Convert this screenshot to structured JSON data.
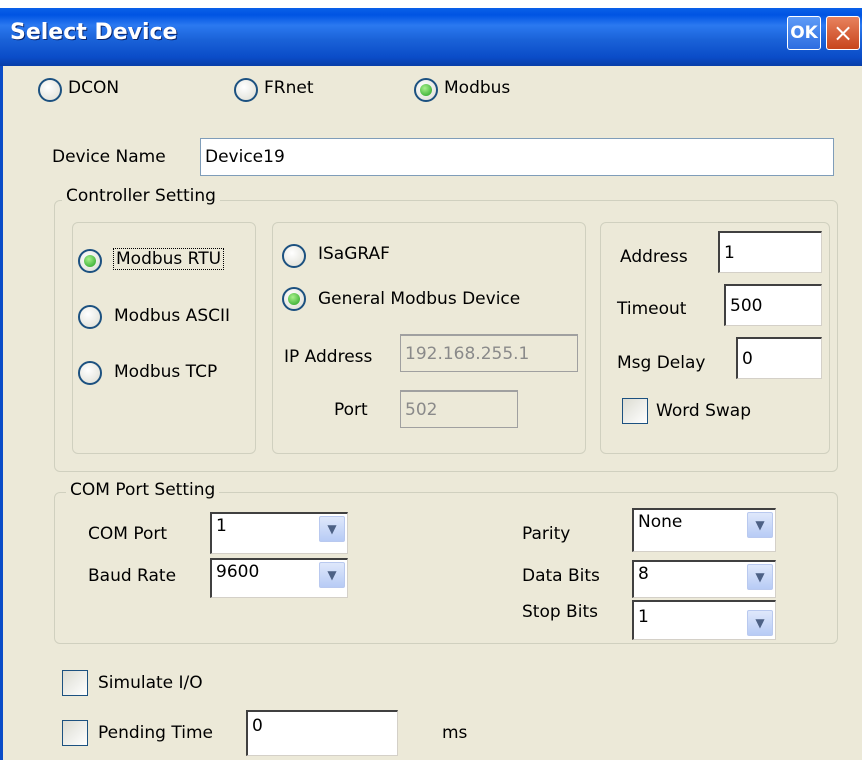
{
  "window": {
    "title": "Select Device",
    "ok_label": "OK",
    "close_glyph": "×"
  },
  "device_type": {
    "options": [
      "DCON",
      "FRnet",
      "Modbus"
    ],
    "selected": "Modbus"
  },
  "device_name": {
    "label": "Device Name",
    "value": "Device19"
  },
  "controller_setting": {
    "title": "Controller Setting",
    "protocol": {
      "options": [
        "Modbus RTU",
        "Modbus ASCII",
        "Modbus TCP"
      ],
      "selected": "Modbus RTU"
    },
    "device_kind": {
      "options": [
        "ISaGRAF",
        "General Modbus Device"
      ],
      "selected": "General Modbus Device"
    },
    "ip_address": {
      "label": "IP Address",
      "value": "192.168.255.1"
    },
    "port": {
      "label": "Port",
      "value": "502"
    },
    "address": {
      "label": "Address",
      "value": "1"
    },
    "timeout": {
      "label": "Timeout",
      "value": "500"
    },
    "msg_delay": {
      "label": "Msg Delay",
      "value": "0"
    },
    "word_swap": {
      "label": "Word Swap",
      "checked": false
    }
  },
  "com_port_setting": {
    "title": "COM Port Setting",
    "com_port": {
      "label": "COM Port",
      "value": "1"
    },
    "baud_rate": {
      "label": "Baud Rate",
      "value": "9600"
    },
    "parity": {
      "label": "Parity",
      "value": "None"
    },
    "data_bits": {
      "label": "Data Bits",
      "value": "8"
    },
    "stop_bits": {
      "label": "Stop Bits",
      "value": "1"
    }
  },
  "simulate_io": {
    "label": "Simulate I/O",
    "checked": false
  },
  "pending_time": {
    "label": "Pending Time",
    "value": "0",
    "unit": "ms",
    "checked": false
  },
  "colors": {
    "titlebar": "#0a4cc8",
    "dialog_bg": "#ece9d8",
    "radio_selected": "#21a121"
  }
}
